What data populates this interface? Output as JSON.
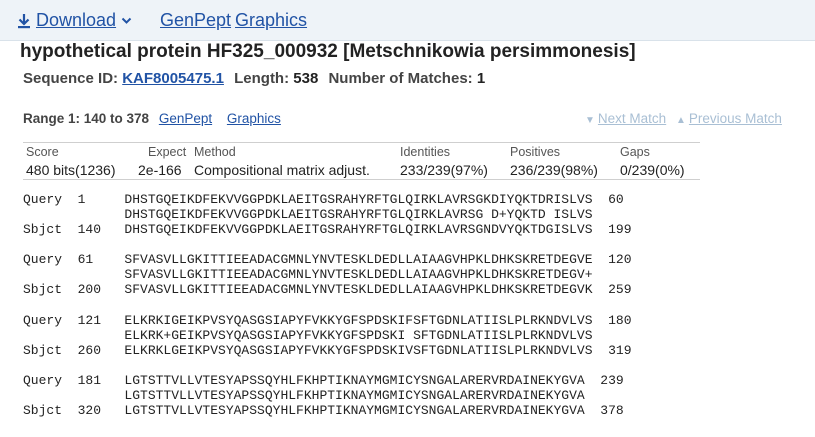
{
  "toolbar": {
    "download_label": "Download",
    "genpept_label": "GenPept",
    "graphics_label": "Graphics"
  },
  "record": {
    "title": "hypothetical protein HF325_000932 [Metschnikowia persimmonesis]",
    "sequence_id_label": "Sequence ID:",
    "sequence_id": "KAF8005475.1",
    "length_label": "Length:",
    "length": "538",
    "matches_label": "Number of Matches:",
    "matches": "1"
  },
  "range": {
    "label": "Range 1: 140 to 378",
    "genpept_label": "GenPept",
    "graphics_label": "Graphics",
    "next_match": "Next Match",
    "previous_match": "Previous Match"
  },
  "stats": {
    "headers": [
      "Score",
      "Expect",
      "Method",
      "Identities",
      "Positives",
      "Gaps"
    ],
    "values": [
      "480 bits(1236)",
      "2e-166",
      "Compositional matrix adjust.",
      "233/239(97%)",
      "236/239(98%)",
      "0/239(0%)"
    ]
  },
  "alignment": [
    {
      "query": "Query  1     DHSTGQEIKDFEKVVGGPDKLAEITGSRAHYRFTGLQIRKLAVRSGKDIYQKTDRISLVS  60",
      "match": "             DHSTGQEIKDFEKVVGGPDKLAEITGSRAHYRFTGLQIRKLAVRSG D+YQKTD ISLVS",
      "sbjct": "Sbjct  140   DHSTGQEIKDFEKVVGGPDKLAEITGSRAHYRFTGLQIRKLAVRSGNDVYQKTDGISLVS  199"
    },
    {
      "query": "Query  61    SFVASVLLGKITTIEEADACGMNLYNVTESKLDEDLLAIAAGVHPKLDHKSKRETDEGVE  120",
      "match": "             SFVASVLLGKITTIEEADACGMNLYNVTESKLDEDLLAIAAGVHPKLDHKSKRETDEGV+",
      "sbjct": "Sbjct  200   SFVASVLLGKITTIEEADACGMNLYNVTESKLDEDLLAIAAGVHPKLDHKSKRETDEGVK  259"
    },
    {
      "query": "Query  121   ELKRKIGEIKPVSYQASGSIAPYFVKKYGFSPDSKIFSFTGDNLATIISLPLRKNDVLVS  180",
      "match": "             ELKRK+GEIKPVSYQASGSIAPYFVKKYGFSPDSKI SFTGDNLATIISLPLRKNDVLVS",
      "sbjct": "Sbjct  260   ELKRKLGEIKPVSYQASGSIAPYFVKKYGFSPDSKIVSFTGDNLATIISLPLRKNDVLVS  319"
    },
    {
      "query": "Query  181   LGTSTTVLLVTESYAPSSQYHLFKHPTIKNAYMGMICYSNGALARERVRDAINEKYGVA  239",
      "match": "             LGTSTTVLLVTESYAPSSQYHLFKHPTIKNAYMGMICYSNGALARERVRDAINEKYGVA",
      "sbjct": "Sbjct  320   LGTSTTVLLVTESYAPSSQYHLFKHPTIKNAYMGMICYSNGALARERVRDAINEKYGVA  378"
    }
  ]
}
